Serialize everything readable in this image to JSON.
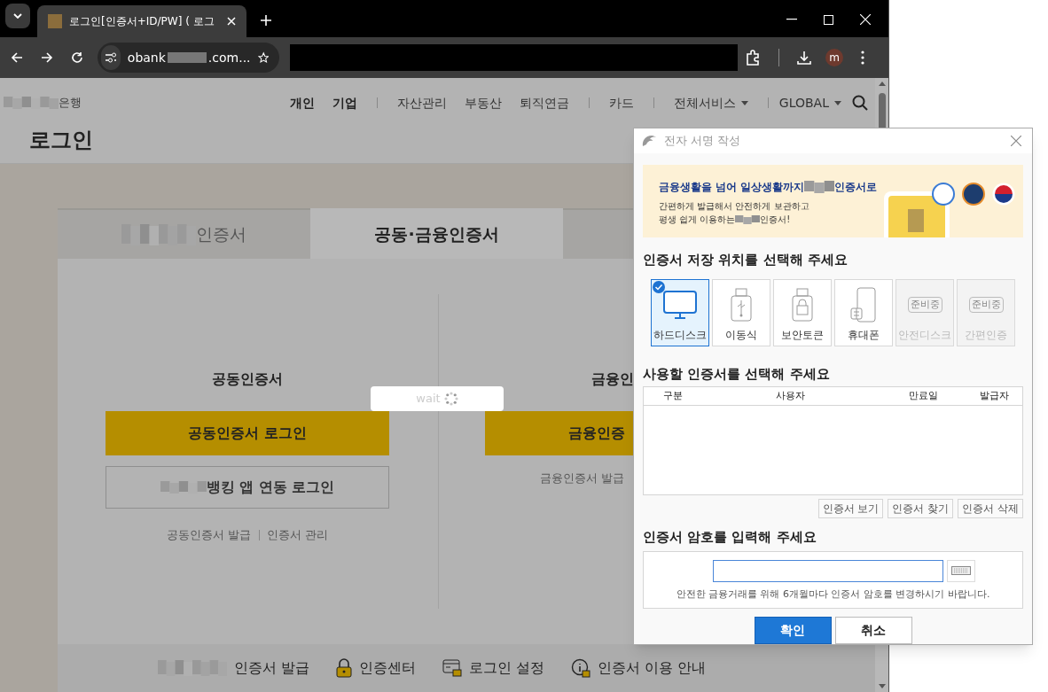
{
  "browser": {
    "tab_title": "로그인[인증서+ID/PW] ( 로그",
    "url_start": "obank",
    "url_end": ".com...",
    "profile": "m"
  },
  "site": {
    "bank_suffix": "은행",
    "nav": [
      {
        "label": "개인",
        "bold": true
      },
      {
        "label": "기업",
        "bold": true
      },
      {
        "label": "자산관리",
        "bold": false
      },
      {
        "label": "부동산",
        "bold": false
      },
      {
        "label": "퇴직연금",
        "bold": false
      },
      {
        "label": "카드",
        "bold": false
      },
      {
        "label": "전체서비스",
        "bold": false,
        "menu": true
      }
    ],
    "global": "GLOBAL",
    "title": "로그인"
  },
  "login_tabs": [
    {
      "label": "인증서",
      "selected": false,
      "redacted": true
    },
    {
      "label": "공동·금융인증서",
      "selected": true,
      "redacted": false
    },
    {
      "selected": false
    }
  ],
  "left": {
    "heading": "공동인증서",
    "primary": "공동인증서 로그인",
    "secondary": "뱅킹 앱 연동 로그인",
    "links": [
      "공동인증서 발급",
      "인증서 관리"
    ]
  },
  "right": {
    "heading": "금융인",
    "primary": "금융인증",
    "link": "금융인증서 발급"
  },
  "wait": "wait",
  "footer_links": [
    {
      "label": "인증서 발급",
      "kind": "blurred"
    },
    {
      "label": "인증센터",
      "kind": "lock"
    },
    {
      "label": "로그인 설정",
      "kind": "card"
    },
    {
      "label": "인증서 이용 안내",
      "kind": "info"
    }
  ],
  "dialog": {
    "title": "전자 서명 작성",
    "banner": {
      "headline_start": "금융생활을 넘어 일상생활까지",
      "headline_end": "인증서로",
      "line1": "간편하게 발급해서 안전하게 보관하고",
      "line2_start": "평생 쉽게 이용하는",
      "line2_end": "인증서!"
    },
    "storage_heading": "인증서 저장 위치를 선택해 주세요",
    "storage": [
      {
        "label": "하드디스크",
        "kind": "monitor",
        "selected": true,
        "disabled": false
      },
      {
        "label": "이동식",
        "kind": "usb",
        "selected": false,
        "disabled": false
      },
      {
        "label": "보안토큰",
        "kind": "token",
        "selected": false,
        "disabled": false
      },
      {
        "label": "휴대폰",
        "kind": "phone",
        "selected": false,
        "disabled": false
      },
      {
        "label": "안전디스크",
        "kind": "pending",
        "badge": "준비중",
        "selected": false,
        "disabled": true
      },
      {
        "label": "간편인증",
        "kind": "pending",
        "badge": "준비중",
        "selected": false,
        "disabled": true
      }
    ],
    "table_heading": "사용할 인증서를 선택해 주세요",
    "columns": [
      "구분",
      "사용자",
      "만료일",
      "발급자"
    ],
    "table_buttons": [
      "인증서 보기",
      "인증서 찾기",
      "인증서 삭제"
    ],
    "password_heading": "인증서 암호를 입력해 주세요",
    "note": "안전한 금융거래를 위해 6개월마다 인증서 암호를 변경하시기 바랍니다.",
    "confirm": "확인",
    "cancel": "취소"
  }
}
